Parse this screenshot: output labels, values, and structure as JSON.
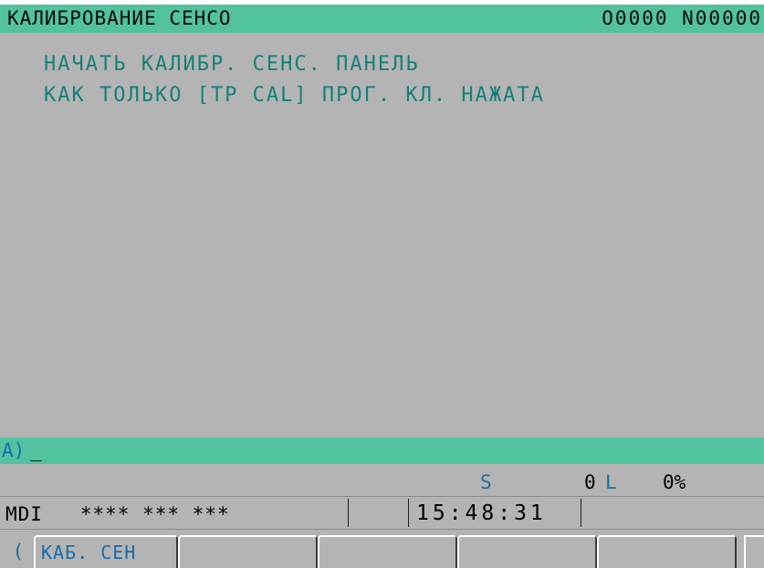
{
  "header": {
    "screen_title": "КАЛИБРОВАНИЕ СЕНСО",
    "program_number": "O0000 N00000"
  },
  "message": {
    "line1": "НАЧАТЬ КАЛИБР. СЕНС. ПАНЕЛЬ",
    "line2": "КАК ТОЛЬКО [TP CAL] ПРОГ. КЛ. НАЖАТА"
  },
  "input": {
    "prompt": "A)",
    "cursor": "_"
  },
  "status": {
    "spindle_label": "S",
    "spindle_value": "0",
    "load_label": "L",
    "load_percent": "0%"
  },
  "mode_bar": {
    "mode": "MDI",
    "status_fields": "**** *** ***",
    "clock": "15:48:31"
  },
  "softkeys": {
    "prev": "(",
    "keys": [
      {
        "label": "КАБ. СЕН"
      },
      {
        "label": ""
      },
      {
        "label": ""
      },
      {
        "label": ""
      },
      {
        "label": ""
      }
    ]
  },
  "colors": {
    "header_bar": "#52c2a0",
    "screen_background": "#b4b4b4",
    "message_text": "#16807a",
    "key_text": "#1a6ea8"
  }
}
